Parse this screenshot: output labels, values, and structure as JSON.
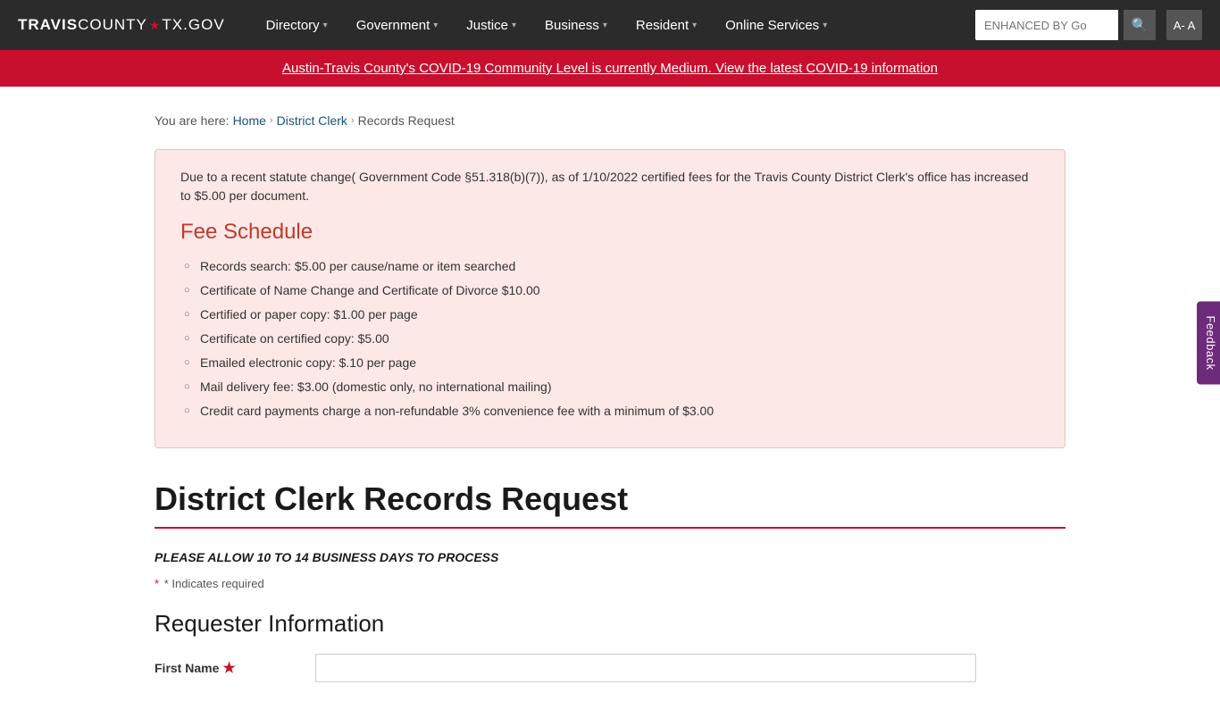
{
  "site": {
    "logo_travis": "TRAVIS",
    "logo_county": "COUNTY",
    "logo_star": "★",
    "logo_gov": "TX.GOV"
  },
  "nav": {
    "items": [
      {
        "label": "Directory",
        "id": "directory"
      },
      {
        "label": "Government",
        "id": "government"
      },
      {
        "label": "Justice",
        "id": "justice"
      },
      {
        "label": "Business",
        "id": "business"
      },
      {
        "label": "Resident",
        "id": "resident"
      },
      {
        "label": "Online Services",
        "id": "online-services"
      }
    ],
    "search_placeholder": "ENHANCED BY Go",
    "search_icon": "🔍",
    "aa_label": "A- A"
  },
  "covid_banner": {
    "text": "Austin-Travis County's COVID-19 Community Level is currently Medium. View the latest COVID-19 information"
  },
  "breadcrumb": {
    "you_are_here": "You are here:",
    "home": "Home",
    "district_clerk": "District Clerk",
    "current": "Records Request"
  },
  "fee_box": {
    "notice": "Due to a recent statute change( Government Code §51.318(b)(7)), as of 1/10/2022 certified fees for the Travis County District Clerk's office has increased to $5.00 per document.",
    "heading": "Fee Schedule",
    "items": [
      "Records search: $5.00 per cause/name or item searched",
      "Certificate of Name Change and Certificate of Divorce $10.00",
      "Certified or paper copy: $1.00 per page",
      "Certificate on certified copy: $5.00",
      "Emailed electronic copy: $.10 per page",
      "Mail delivery fee: $3.00 (domestic only, no international mailing)",
      "Credit card payments charge a non-refundable 3% convenience fee with a minimum of $3.00"
    ]
  },
  "page": {
    "title": "District Clerk Records Request",
    "processing_notice": "PLEASE ALLOW 10 TO 14 BUSINESS DAYS TO PROCESS",
    "required_note": "* Indicates required",
    "requester_heading": "Requester Information",
    "first_name_label": "First Name",
    "first_name_required": true
  },
  "feedback": {
    "label": "Feedback"
  }
}
